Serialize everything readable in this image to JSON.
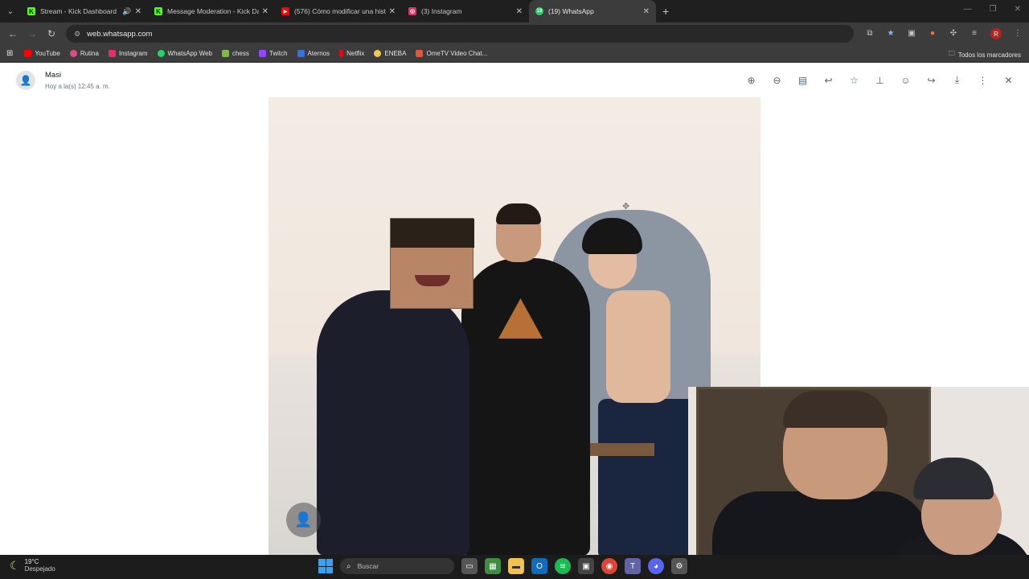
{
  "browser": {
    "tabs": [
      {
        "title": "Stream - Kick Dashboard",
        "favicon_color": "#53fc18",
        "favicon_letter": "K",
        "audio": true,
        "active": false
      },
      {
        "title": "Message Moderation - Kick Da",
        "favicon_color": "#53fc18",
        "favicon_letter": "K",
        "audio": false,
        "active": false
      },
      {
        "title": "(576) Cómo modificar una histo",
        "favicon_color": "#ff0000",
        "favicon_letter": "▶",
        "audio": false,
        "active": false
      },
      {
        "title": "(3) Instagram",
        "favicon_color": "#e1306c",
        "favicon_letter": "◎",
        "audio": false,
        "active": false
      },
      {
        "title": "(19) WhatsApp",
        "favicon_color": "#25d366",
        "favicon_letter": "19",
        "audio": false,
        "active": true
      }
    ],
    "new_tab_icon": "+",
    "url": "web.whatsapp.com",
    "bookmarks": [
      {
        "label": "YouTube",
        "color": "#ff0000"
      },
      {
        "label": "Rutina",
        "color": "#e04a8a"
      },
      {
        "label": "Instagram",
        "color": "#e1306c"
      },
      {
        "label": "WhatsApp Web",
        "color": "#25d366"
      },
      {
        "label": "chess",
        "color": "#81b64c"
      },
      {
        "label": "Twitch",
        "color": "#9146ff"
      },
      {
        "label": "Aternos",
        "color": "#3b6fd6"
      },
      {
        "label": "Netflix",
        "color": "#e50914"
      },
      {
        "label": "ENEBA",
        "color": "#f2c94c"
      },
      {
        "label": "OmeTV Video Chat...",
        "color": "#e2553f"
      }
    ],
    "all_bookmarks_label": "Todos los marcadores",
    "profile_letter": "R"
  },
  "viewer": {
    "sender_name": "Masi",
    "timestamp": "Hoy a la(s) 12:45 a. m.",
    "tools": [
      "zoom-in",
      "zoom-out",
      "go-to-message",
      "reply",
      "star",
      "pin",
      "react",
      "forward",
      "download",
      "more",
      "close"
    ]
  },
  "taskbar": {
    "temperature": "19°C",
    "weather": "Despejado",
    "search_placeholder": "Buscar"
  }
}
